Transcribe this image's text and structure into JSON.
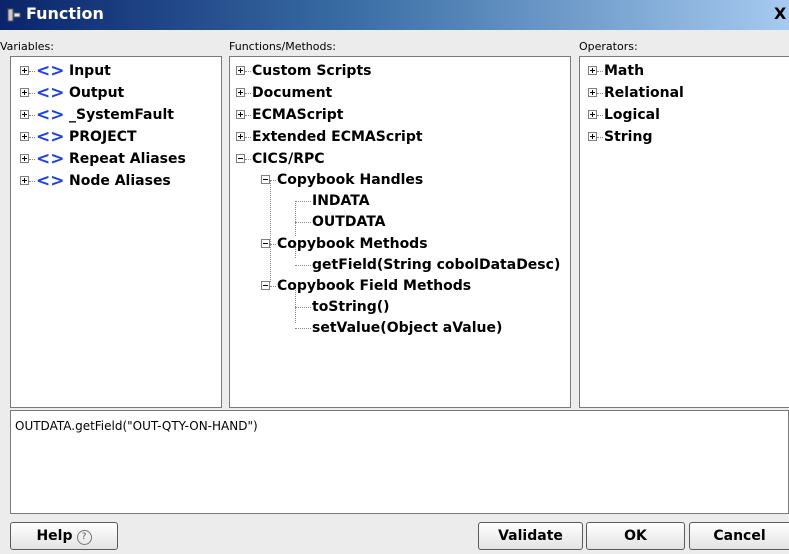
{
  "window": {
    "title": "Function",
    "close_label": "X"
  },
  "panels": {
    "variables": {
      "label": "Variables:",
      "items": [
        {
          "label": "Input",
          "icon": "angle-brackets-icon"
        },
        {
          "label": "Output",
          "icon": "angle-brackets-icon"
        },
        {
          "label": "_SystemFault",
          "icon": "angle-brackets-icon"
        },
        {
          "label": "PROJECT",
          "icon": "angle-brackets-icon"
        },
        {
          "label": "Repeat Aliases",
          "icon": "angle-brackets-icon"
        },
        {
          "label": "Node Aliases",
          "icon": "angle-brackets-icon"
        }
      ]
    },
    "functions": {
      "label": "Functions/Methods:",
      "items": [
        {
          "label": "Custom Scripts",
          "expanded": false
        },
        {
          "label": "Document",
          "expanded": false
        },
        {
          "label": "ECMAScript",
          "expanded": false
        },
        {
          "label": "Extended ECMAScript",
          "expanded": false
        },
        {
          "label": "CICS/RPC",
          "expanded": true,
          "children": [
            {
              "label": "Copybook Handles",
              "expanded": true,
              "children": [
                "INDATA",
                "OUTDATA"
              ]
            },
            {
              "label": "Copybook Methods",
              "expanded": true,
              "children": [
                "getField(String cobolDataDesc)"
              ]
            },
            {
              "label": "Copybook Field Methods",
              "expanded": true,
              "children": [
                "toString()",
                "setValue(Object aValue)"
              ]
            }
          ]
        }
      ]
    },
    "operators": {
      "label": "Operators:",
      "items": [
        {
          "label": "Math"
        },
        {
          "label": "Relational"
        },
        {
          "label": "Logical"
        },
        {
          "label": "String"
        }
      ]
    }
  },
  "expression": {
    "value": "OUTDATA.getField(\"OUT-QTY-ON-HAND\")"
  },
  "buttons": {
    "help": "Help",
    "help_icon": "?",
    "validate": "Validate",
    "ok": "OK",
    "cancel": "Cancel"
  },
  "colors": {
    "title_gradient_start": "#0a246a",
    "title_gradient_end": "#a6caf0",
    "variable_icon": "#1a3df0"
  }
}
